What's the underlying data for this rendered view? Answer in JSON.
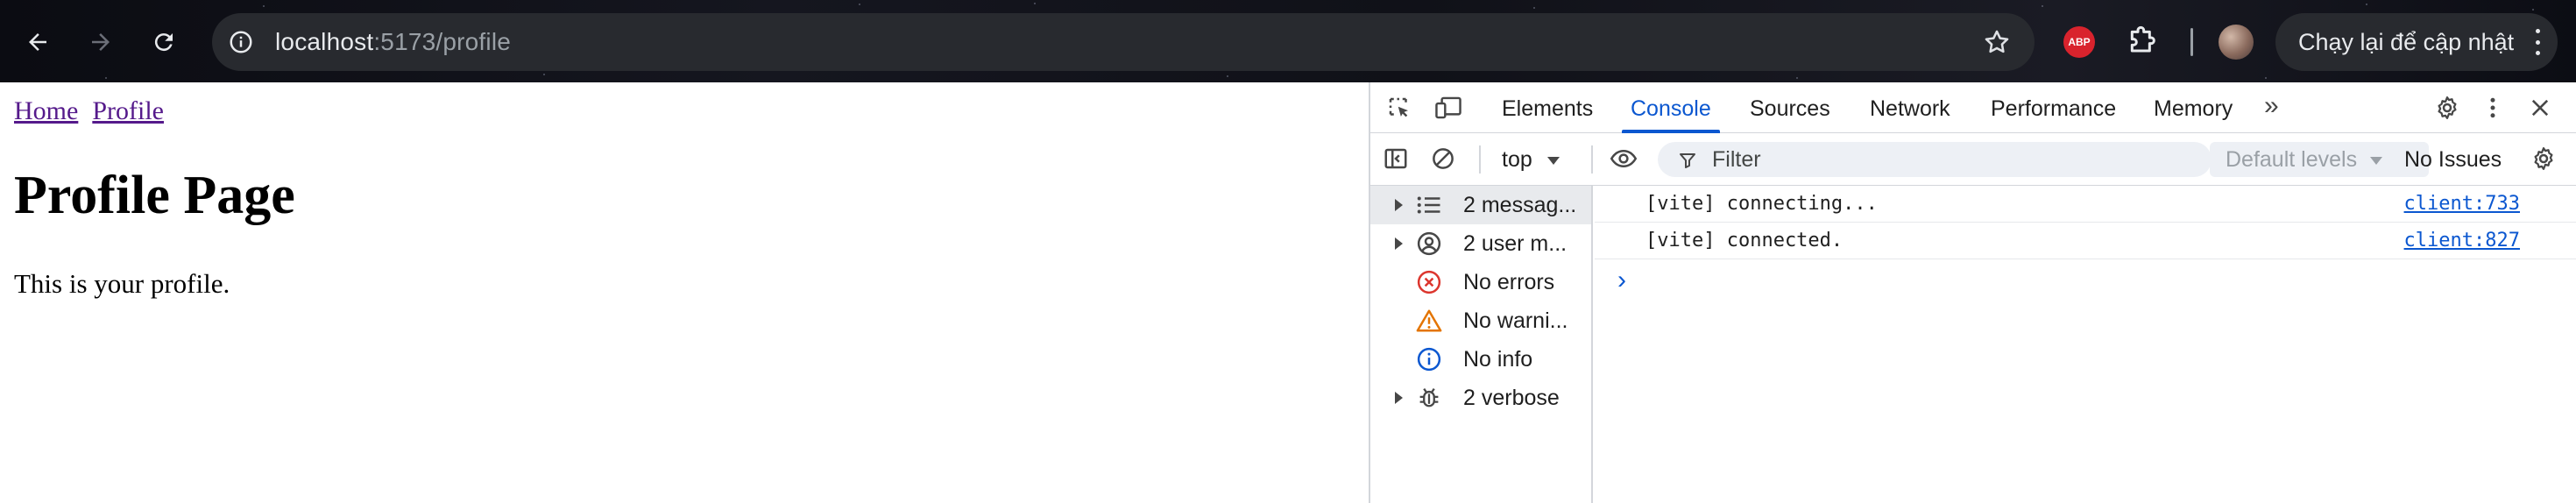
{
  "browser": {
    "url_host": "localhost",
    "url_path": ":5173/profile",
    "extension_abp_label": "ABP",
    "relaunch_label": "Chạy lại để cập nhật",
    "icons": {
      "back": "arrow-left-icon",
      "forward": "arrow-right-icon",
      "reload": "reload-icon",
      "site_info": "site-info-icon",
      "bookmark": "star-icon",
      "extensions": "puzzle-icon",
      "menu": "more-vert-icon"
    }
  },
  "page": {
    "nav": [
      {
        "label": "Home"
      },
      {
        "label": "Profile"
      }
    ],
    "title": "Profile Page",
    "text": "This is your profile."
  },
  "devtools": {
    "tabs": [
      {
        "label": "Elements",
        "active": false
      },
      {
        "label": "Console",
        "active": true
      },
      {
        "label": "Sources",
        "active": false
      },
      {
        "label": "Network",
        "active": false
      },
      {
        "label": "Performance",
        "active": false
      },
      {
        "label": "Memory",
        "active": false
      }
    ],
    "more_tabs": "»",
    "context": "top",
    "filter_placeholder": "Filter",
    "levels": "Default levels",
    "issues": "No Issues",
    "sidebar": [
      {
        "label": "2 messag...",
        "icon": "list-icon",
        "expandable": true,
        "selected": true
      },
      {
        "label": "2 user m...",
        "icon": "user-icon",
        "expandable": true,
        "selected": false
      },
      {
        "label": "No errors",
        "icon": "error-icon",
        "expandable": false,
        "selected": false
      },
      {
        "label": "No warni...",
        "icon": "warning-icon",
        "expandable": false,
        "selected": false
      },
      {
        "label": "No info",
        "icon": "info-icon",
        "expandable": false,
        "selected": false
      },
      {
        "label": "2 verbose",
        "icon": "bug-icon",
        "expandable": true,
        "selected": false
      }
    ],
    "messages": [
      {
        "text": "[vite] connecting...",
        "source": "client:733"
      },
      {
        "text": "[vite] connected.",
        "source": "client:827"
      }
    ],
    "prompt": "›",
    "colors": {
      "accent": "#0b57d0",
      "error": "#dc362e",
      "warning": "#e37400",
      "info": "#0b57d0"
    }
  }
}
